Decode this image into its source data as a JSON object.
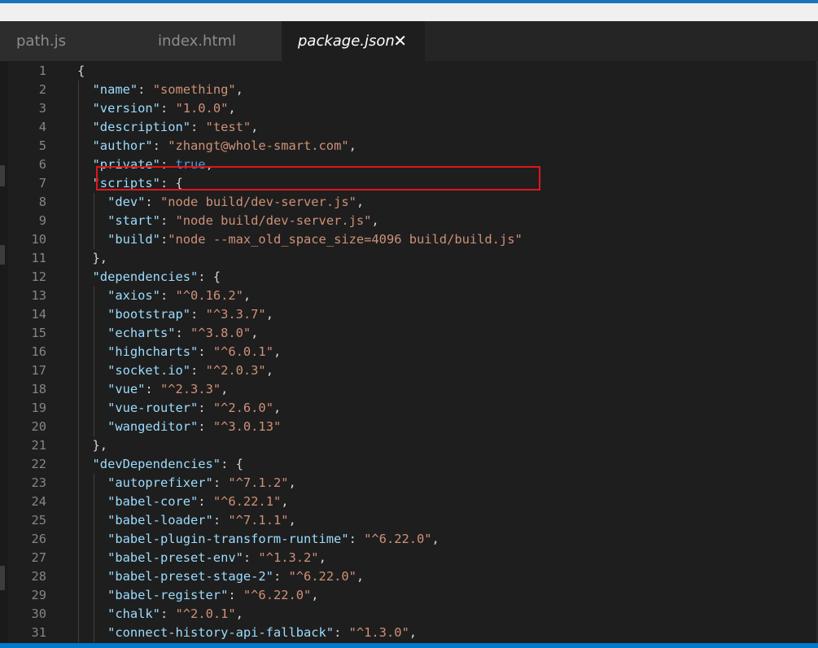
{
  "tabs": [
    {
      "label": "path.js",
      "active": false
    },
    {
      "label": "index.html",
      "active": false
    },
    {
      "label": "package.json",
      "active": true
    }
  ],
  "tab_close_glyph": "✕",
  "lines": [
    {
      "n": 1,
      "indent": 0,
      "tokens": [
        [
          "p",
          "{"
        ]
      ]
    },
    {
      "n": 2,
      "indent": 1,
      "tokens": [
        [
          "k",
          "\"name\""
        ],
        [
          "p",
          ": "
        ],
        [
          "s",
          "\"something\""
        ],
        [
          "p",
          ","
        ]
      ]
    },
    {
      "n": 3,
      "indent": 1,
      "tokens": [
        [
          "k",
          "\"version\""
        ],
        [
          "p",
          ": "
        ],
        [
          "s",
          "\"1.0.0\""
        ],
        [
          "p",
          ","
        ]
      ]
    },
    {
      "n": 4,
      "indent": 1,
      "tokens": [
        [
          "k",
          "\"description\""
        ],
        [
          "p",
          ": "
        ],
        [
          "s",
          "\"test\""
        ],
        [
          "p",
          ","
        ]
      ]
    },
    {
      "n": 5,
      "indent": 1,
      "tokens": [
        [
          "k",
          "\"author\""
        ],
        [
          "p",
          ": "
        ],
        [
          "s",
          "\"zhangt@whole-smart.com\""
        ],
        [
          "p",
          ","
        ]
      ]
    },
    {
      "n": 6,
      "indent": 1,
      "tokens": [
        [
          "k",
          "\"private\""
        ],
        [
          "p",
          ": "
        ],
        [
          "b",
          "true"
        ],
        [
          "p",
          ","
        ]
      ]
    },
    {
      "n": 7,
      "indent": 1,
      "tokens": [
        [
          "k",
          "\"scripts\""
        ],
        [
          "p",
          ": {"
        ]
      ]
    },
    {
      "n": 8,
      "indent": 2,
      "tokens": [
        [
          "k",
          "\"dev\""
        ],
        [
          "p",
          ": "
        ],
        [
          "s",
          "\"node build/dev-server.js\""
        ],
        [
          "p",
          ","
        ]
      ]
    },
    {
      "n": 9,
      "indent": 2,
      "tokens": [
        [
          "k",
          "\"start\""
        ],
        [
          "p",
          ": "
        ],
        [
          "s",
          "\"node build/dev-server.js\""
        ],
        [
          "p",
          ","
        ]
      ]
    },
    {
      "n": 10,
      "indent": 2,
      "tokens": [
        [
          "k",
          "\"build\""
        ],
        [
          "p",
          ":"
        ],
        [
          "s",
          "\"node --max_old_space_size=4096 build/build.js\""
        ]
      ]
    },
    {
      "n": 11,
      "indent": 1,
      "tokens": [
        [
          "p",
          "},"
        ]
      ]
    },
    {
      "n": 12,
      "indent": 1,
      "tokens": [
        [
          "k",
          "\"dependencies\""
        ],
        [
          "p",
          ": {"
        ]
      ]
    },
    {
      "n": 13,
      "indent": 2,
      "tokens": [
        [
          "k",
          "\"axios\""
        ],
        [
          "p",
          ": "
        ],
        [
          "s",
          "\"^0.16.2\""
        ],
        [
          "p",
          ","
        ]
      ]
    },
    {
      "n": 14,
      "indent": 2,
      "tokens": [
        [
          "k",
          "\"bootstrap\""
        ],
        [
          "p",
          ": "
        ],
        [
          "s",
          "\"^3.3.7\""
        ],
        [
          "p",
          ","
        ]
      ]
    },
    {
      "n": 15,
      "indent": 2,
      "tokens": [
        [
          "k",
          "\"echarts\""
        ],
        [
          "p",
          ": "
        ],
        [
          "s",
          "\"^3.8.0\""
        ],
        [
          "p",
          ","
        ]
      ]
    },
    {
      "n": 16,
      "indent": 2,
      "tokens": [
        [
          "k",
          "\"highcharts\""
        ],
        [
          "p",
          ": "
        ],
        [
          "s",
          "\"^6.0.1\""
        ],
        [
          "p",
          ","
        ]
      ]
    },
    {
      "n": 17,
      "indent": 2,
      "tokens": [
        [
          "k",
          "\"socket.io\""
        ],
        [
          "p",
          ": "
        ],
        [
          "s",
          "\"^2.0.3\""
        ],
        [
          "p",
          ","
        ]
      ]
    },
    {
      "n": 18,
      "indent": 2,
      "tokens": [
        [
          "k",
          "\"vue\""
        ],
        [
          "p",
          ": "
        ],
        [
          "s",
          "\"^2.3.3\""
        ],
        [
          "p",
          ","
        ]
      ]
    },
    {
      "n": 19,
      "indent": 2,
      "tokens": [
        [
          "k",
          "\"vue-router\""
        ],
        [
          "p",
          ": "
        ],
        [
          "s",
          "\"^2.6.0\""
        ],
        [
          "p",
          ","
        ]
      ]
    },
    {
      "n": 20,
      "indent": 2,
      "tokens": [
        [
          "k",
          "\"wangeditor\""
        ],
        [
          "p",
          ": "
        ],
        [
          "s",
          "\"^3.0.13\""
        ]
      ]
    },
    {
      "n": 21,
      "indent": 1,
      "tokens": [
        [
          "p",
          "},"
        ]
      ]
    },
    {
      "n": 22,
      "indent": 1,
      "tokens": [
        [
          "k",
          "\"devDependencies\""
        ],
        [
          "p",
          ": {"
        ]
      ]
    },
    {
      "n": 23,
      "indent": 2,
      "tokens": [
        [
          "k",
          "\"autoprefixer\""
        ],
        [
          "p",
          ": "
        ],
        [
          "s",
          "\"^7.1.2\""
        ],
        [
          "p",
          ","
        ]
      ]
    },
    {
      "n": 24,
      "indent": 2,
      "tokens": [
        [
          "k",
          "\"babel-core\""
        ],
        [
          "p",
          ": "
        ],
        [
          "s",
          "\"^6.22.1\""
        ],
        [
          "p",
          ","
        ]
      ]
    },
    {
      "n": 25,
      "indent": 2,
      "tokens": [
        [
          "k",
          "\"babel-loader\""
        ],
        [
          "p",
          ": "
        ],
        [
          "s",
          "\"^7.1.1\""
        ],
        [
          "p",
          ","
        ]
      ]
    },
    {
      "n": 26,
      "indent": 2,
      "tokens": [
        [
          "k",
          "\"babel-plugin-transform-runtime\""
        ],
        [
          "p",
          ": "
        ],
        [
          "s",
          "\"^6.22.0\""
        ],
        [
          "p",
          ","
        ]
      ]
    },
    {
      "n": 27,
      "indent": 2,
      "tokens": [
        [
          "k",
          "\"babel-preset-env\""
        ],
        [
          "p",
          ": "
        ],
        [
          "s",
          "\"^1.3.2\""
        ],
        [
          "p",
          ","
        ]
      ]
    },
    {
      "n": 28,
      "indent": 2,
      "tokens": [
        [
          "k",
          "\"babel-preset-stage-2\""
        ],
        [
          "p",
          ": "
        ],
        [
          "s",
          "\"^6.22.0\""
        ],
        [
          "p",
          ","
        ]
      ]
    },
    {
      "n": 29,
      "indent": 2,
      "tokens": [
        [
          "k",
          "\"babel-register\""
        ],
        [
          "p",
          ": "
        ],
        [
          "s",
          "\"^6.22.0\""
        ],
        [
          "p",
          ","
        ]
      ]
    },
    {
      "n": 30,
      "indent": 2,
      "tokens": [
        [
          "k",
          "\"chalk\""
        ],
        [
          "p",
          ": "
        ],
        [
          "s",
          "\"^2.0.1\""
        ],
        [
          "p",
          ","
        ]
      ]
    },
    {
      "n": 31,
      "indent": 2,
      "tokens": [
        [
          "k",
          "\"connect-history-api-fallback\""
        ],
        [
          "p",
          ": "
        ],
        [
          "s",
          "\"^1.3.0\""
        ],
        [
          "p",
          ","
        ]
      ]
    }
  ],
  "colors": {
    "key": "#9cdcfe",
    "string": "#ce9178",
    "boolean": "#569cd6",
    "punctuation": "#d4d4d4",
    "line_number": "#858585",
    "highlight_box": "#e0151b",
    "editor_bg": "#1e1e1e"
  }
}
